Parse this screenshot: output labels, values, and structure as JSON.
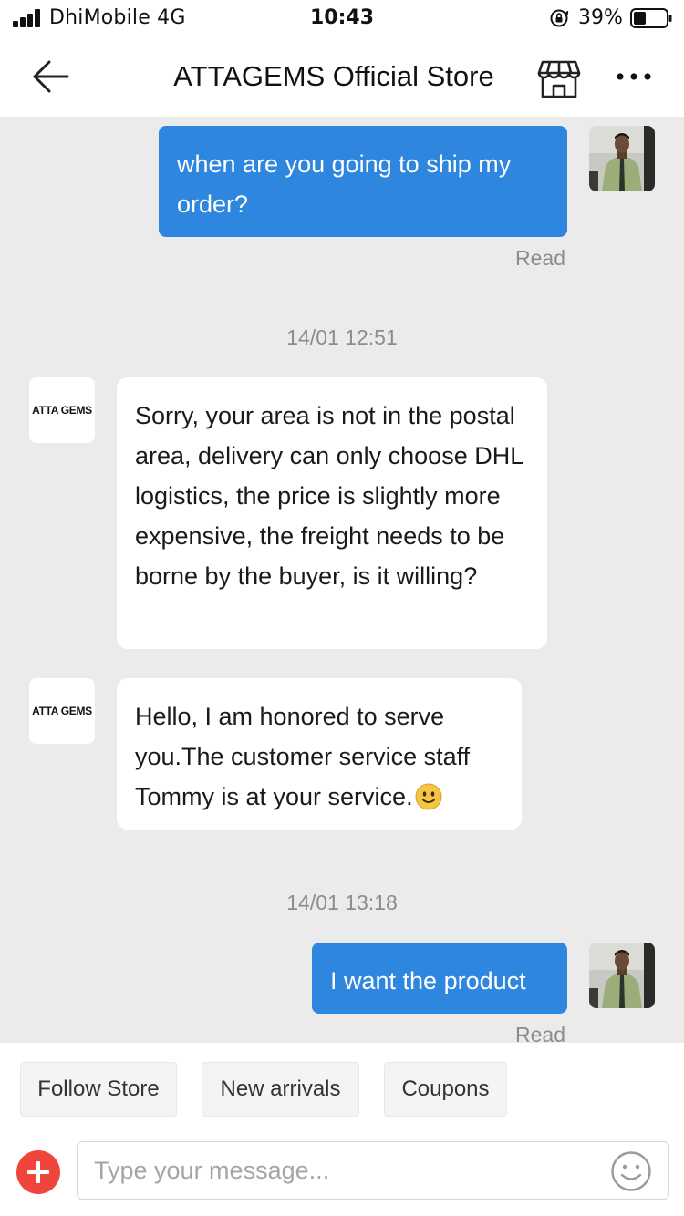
{
  "status_bar": {
    "carrier": "DhiMobile  4G",
    "time": "10:43",
    "battery": "39%",
    "icons": [
      "signal-icon",
      "orientation-lock-icon",
      "battery-icon"
    ]
  },
  "header": {
    "title": "ATTAGEMS Official Store",
    "icons": [
      "back-arrow-icon",
      "store-icon",
      "more-dots-icon"
    ]
  },
  "chat": {
    "messages": [
      {
        "from": "user",
        "text": "when are you going to ship my order?",
        "status": "Read"
      },
      {
        "timestamp": "14/01 12:51"
      },
      {
        "from": "store",
        "avatar_text": "ATTA GEMS",
        "text": "Sorry, your area is not in the postal area, delivery can only choose DHL logistics, the price is slightly more expensive, the freight needs to be borne by the buyer, is it willing?"
      },
      {
        "from": "store",
        "avatar_text": "ATTA GEMS",
        "text": "Hello, I am honored to serve you.The customer service staff Tommy is at your service.",
        "emoji": "smiling-face-emoji"
      },
      {
        "timestamp": "14/01 13:18"
      },
      {
        "from": "user",
        "text": "I want the product",
        "status": "Read"
      }
    ]
  },
  "quick_actions": [
    "Follow Store",
    "New arrivals",
    "Coupons"
  ],
  "composer": {
    "placeholder": "Type your message...",
    "value": "",
    "icons": [
      "plus-icon",
      "smiley-icon"
    ]
  },
  "colors": {
    "outgoing_bubble": "#2e86df",
    "chat_background": "#ebebeb",
    "add_button": "#f0453a",
    "muted_text": "#8c8c8c"
  }
}
